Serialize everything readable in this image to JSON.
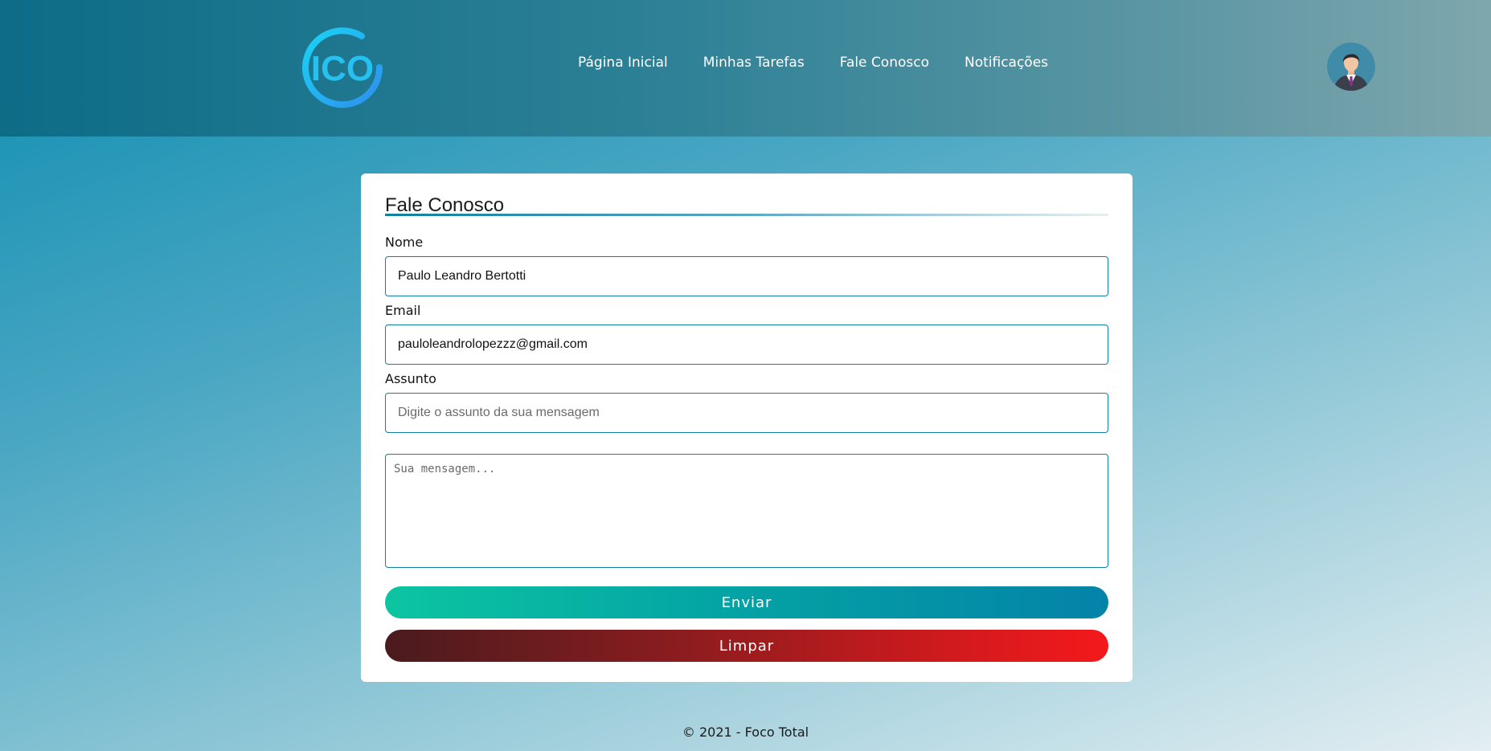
{
  "header": {
    "logo_text": "ICO",
    "nav": [
      {
        "label": "Página Inicial"
      },
      {
        "label": "Minhas Tarefas"
      },
      {
        "label": "Fale Conosco"
      },
      {
        "label": "Notificações"
      }
    ],
    "avatar_icon": "user-avatar-icon"
  },
  "form": {
    "title": "Fale Conosco",
    "name_label": "Nome",
    "name_value": "Paulo Leandro Bertotti",
    "email_label": "Email",
    "email_value": "pauloleandrolopezzz@gmail.com",
    "subject_label": "Assunto",
    "subject_placeholder": "Digite o assunto da sua mensagem",
    "message_placeholder": "Sua mensagem...",
    "send_label": "Enviar",
    "clear_label": "Limpar"
  },
  "footer": {
    "text": "© 2021 - Foco Total"
  },
  "colors": {
    "accent": "#0f7fa3",
    "send_start": "#0cc5a2",
    "send_end": "#0483a8",
    "clear_start": "#4a1b1e",
    "clear_end": "#f4191b"
  }
}
